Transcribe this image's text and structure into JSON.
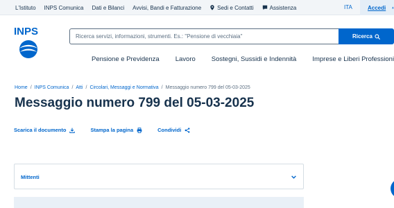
{
  "topbar": {
    "links": [
      "L'Istituto",
      "INPS Comunica",
      "Dati e Bilanci",
      "Avvisi, Bandi e Fatturazione",
      "Sedi e Contatti",
      "Assistenza"
    ],
    "language": "ITA",
    "login": "Accedi"
  },
  "header": {
    "logo": "INPS",
    "search_placeholder": "Ricerca servizi, informazioni, strumenti. Es.: \"Pensione di vecchiaia\"",
    "search_button": "Ricerca"
  },
  "nav": [
    "Pensione e Previdenza",
    "Lavoro",
    "Sostegni, Sussidi e Indennità",
    "Imprese e Liberi Professionisti"
  ],
  "breadcrumb": {
    "items": [
      "Home",
      "INPS Comunica",
      "Atti",
      "Circolari, Messaggi e Normativa"
    ],
    "current": "Messaggio numero 799 del 05-03-2025"
  },
  "page_title": "Messaggio numero 799 del 05-03-2025",
  "actions": {
    "download": "Scarica il documento",
    "print": "Stampa la pagina",
    "share": "Condividi"
  },
  "accordion": {
    "label": "Mittenti"
  },
  "colors": {
    "primary": "#0066cc",
    "text": "#17324d",
    "topbar_bg": "#f2f5f8"
  }
}
